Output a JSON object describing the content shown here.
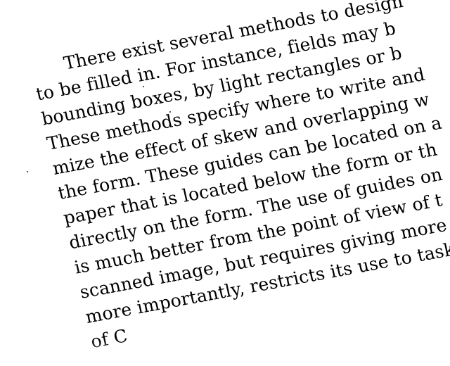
{
  "document": {
    "lines": [
      "There exist several methods to design",
      "to be filled in. For instance, fields may b",
      "bounding boxes, by light rectangles or b",
      "These methods specify where to write and",
      "mize the effect of skew and overlapping w",
      "the form. These guides can be located on a",
      "paper that is located below the form or th",
      "directly on the form. The use of guides on",
      "is much better from the point of view of t",
      "scanned image, but requires giving more",
      "more importantly, restricts its use to task",
      "of                            C"
    ]
  }
}
